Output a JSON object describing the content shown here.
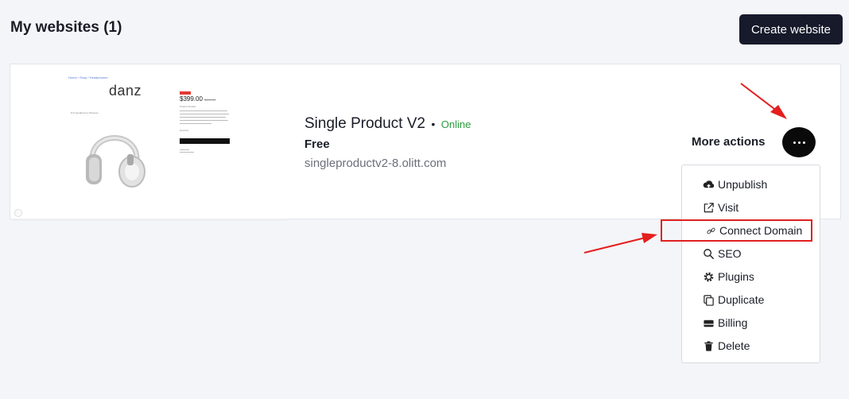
{
  "header": {
    "title": "My websites (1)",
    "create_button": "Create website"
  },
  "website": {
    "name": "Single Product V2",
    "separator": "•",
    "status": "Online",
    "plan": "Free",
    "url": "singleproductv2-8.olitt.com",
    "thumbnail": {
      "breadcrumb": "Home / Shop / Headphones",
      "brand": "danz",
      "price": "$399.00",
      "old_price": "$449.00",
      "product_label": "DJI Headphones Wireless",
      "description_label": "Product Details",
      "quantity_label": "Quantity"
    }
  },
  "actions": {
    "more_label": "More actions",
    "menu": [
      {
        "label": "Unpublish",
        "icon": "cloud-upload-icon"
      },
      {
        "label": "Visit",
        "icon": "external-link-icon"
      },
      {
        "label": "Connect Domain",
        "icon": "link-icon"
      },
      {
        "label": "SEO",
        "icon": "search-icon"
      },
      {
        "label": "Plugins",
        "icon": "gear-icon"
      },
      {
        "label": "Duplicate",
        "icon": "copy-icon"
      },
      {
        "label": "Billing",
        "icon": "billing-icon"
      },
      {
        "label": "Delete",
        "icon": "trash-icon"
      }
    ]
  },
  "colors": {
    "primary_button": "#161a2b",
    "status_online": "#2e9a3f",
    "highlight": "#e02020",
    "page_bg": "#f4f5f8"
  }
}
